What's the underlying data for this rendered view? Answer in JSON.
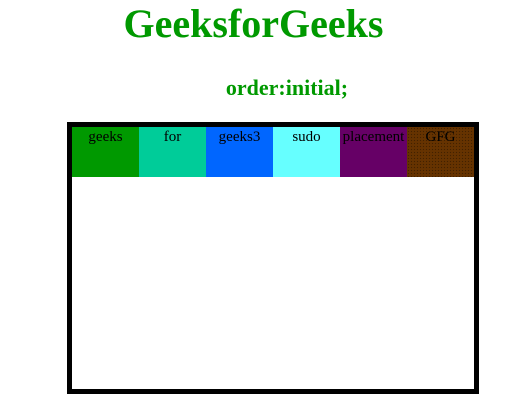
{
  "header": {
    "title": "GeeksforGeeks",
    "subtitle": "order:initial;"
  },
  "colors": {
    "brand": "#009900",
    "border": "#000000"
  },
  "flex": {
    "items": [
      {
        "label": "geeks",
        "color": "#009900"
      },
      {
        "label": "for",
        "color": "#00CC99"
      },
      {
        "label": "geeks3",
        "color": "#0066FF"
      },
      {
        "label": "sudo",
        "color": "#66FFFF"
      },
      {
        "label": "placement",
        "color": "#660066"
      },
      {
        "label": "GFG",
        "color": "#663300"
      }
    ]
  }
}
